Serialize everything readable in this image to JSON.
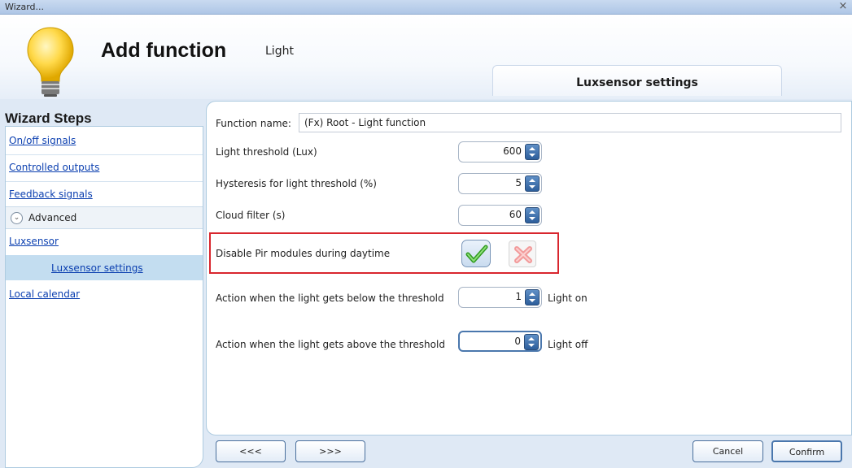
{
  "window": {
    "title": "Wizard...",
    "close_glyph": "×"
  },
  "header": {
    "title": "Add function",
    "subtitle": "Light",
    "icon": "lightbulb-icon",
    "tab_label": "Luxsensor settings"
  },
  "sidebar": {
    "title": "Wizard Steps",
    "items": [
      {
        "label": "On/off signals"
      },
      {
        "label": "Controlled outputs"
      },
      {
        "label": "Feedback signals"
      },
      {
        "label": "Advanced"
      },
      {
        "label": "Luxsensor"
      },
      {
        "label": "Luxsensor settings"
      },
      {
        "label": "Local calendar"
      }
    ],
    "expand_glyph": "⌄"
  },
  "form": {
    "function_name_label": "Function name:",
    "function_name_value": "(Fx) Root - Light function",
    "light_threshold_label": "Light threshold (Lux)",
    "light_threshold_value": "600",
    "hysteresis_label": "Hysteresis for light threshold (%)",
    "hysteresis_value": "5",
    "cloud_filter_label": "Cloud filter (s)",
    "cloud_filter_value": "60",
    "disable_pir_label": "Disable Pir modules during daytime",
    "below_label": "Action when the light gets below the threshold",
    "below_value": "1",
    "below_suffix": "Light on",
    "above_label": "Action when the light gets above the threshold",
    "above_value": "0",
    "above_suffix": "Light off"
  },
  "buttons": {
    "prev": "<<<",
    "next": ">>>",
    "cancel": "Cancel",
    "confirm": "Confirm"
  },
  "colors": {
    "highlight_border": "#d8262e",
    "link": "#0b3fb0",
    "selected_row": "#c3ddf0"
  }
}
